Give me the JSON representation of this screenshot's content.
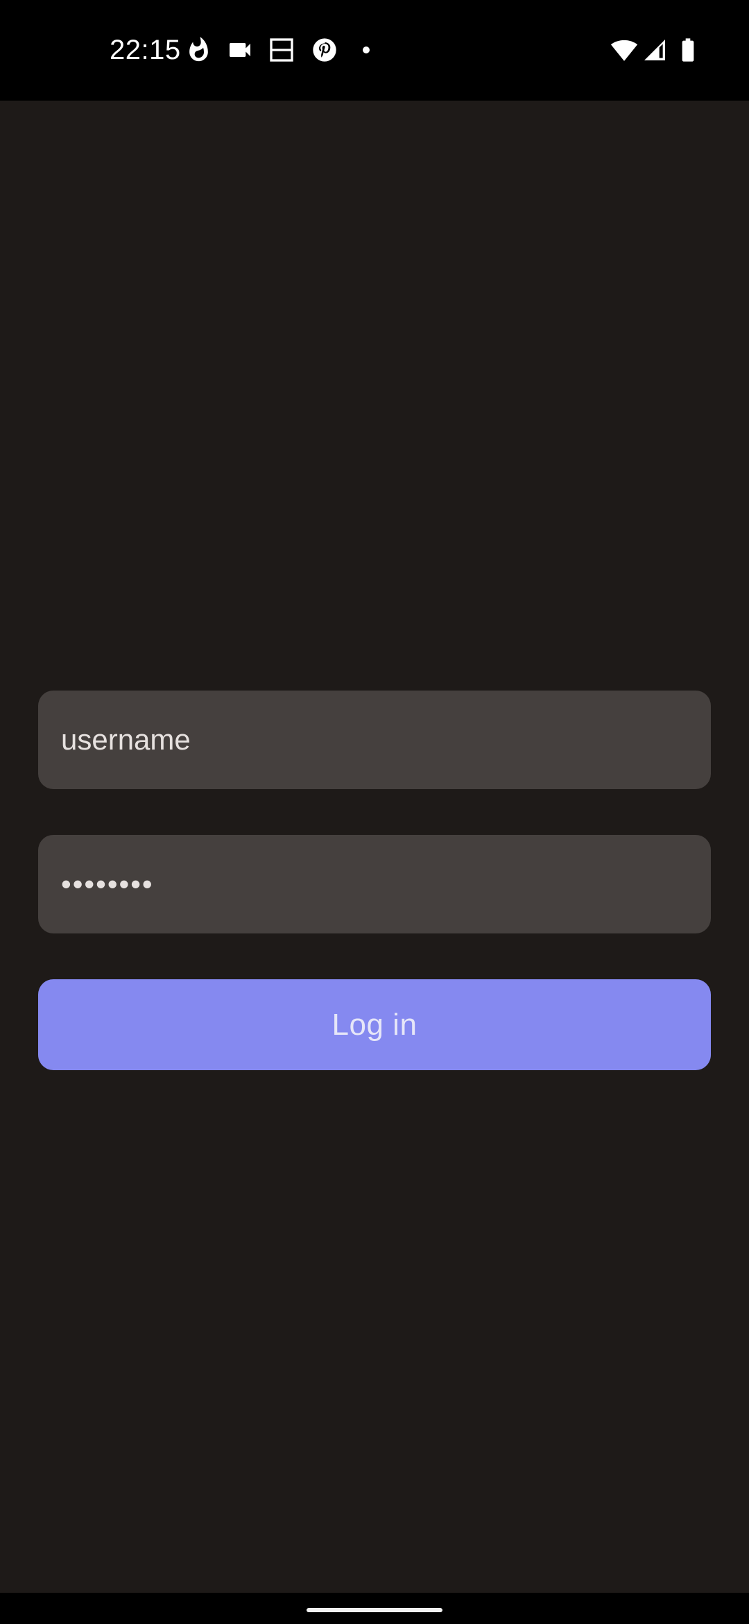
{
  "status_bar": {
    "time": "22:15",
    "left_icons": [
      "flame-icon",
      "video-camera-icon",
      "split-screen-icon",
      "pinterest-icon",
      "notification-dot-icon"
    ],
    "right_icons": [
      "wifi-icon",
      "cell-signal-icon",
      "battery-icon"
    ]
  },
  "login": {
    "username_value": "username",
    "password_value": "••••••••",
    "login_button_label": "Log in"
  },
  "colors": {
    "background": "#1e1a18",
    "field": "#45403e",
    "accent": "#8589f0",
    "status_bar": "#000000"
  }
}
